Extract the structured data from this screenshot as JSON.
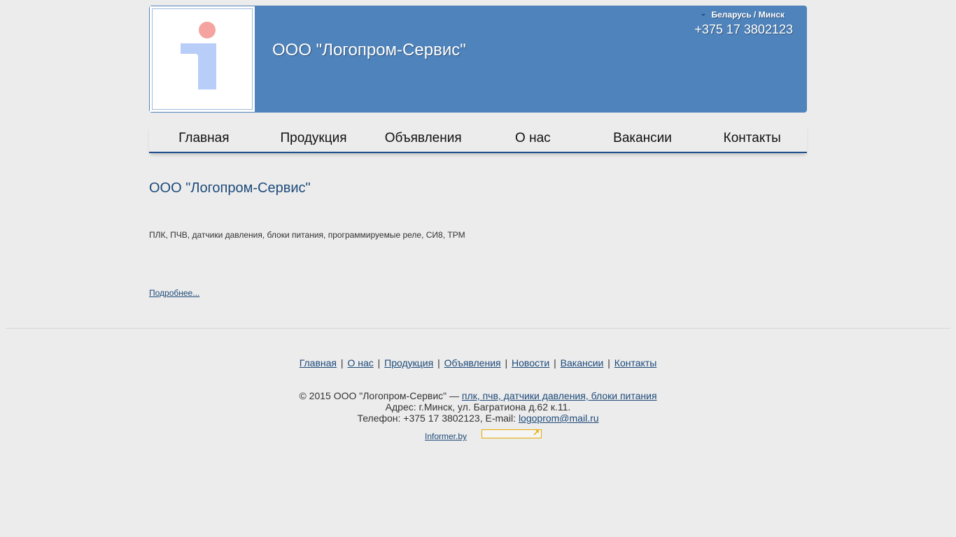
{
  "header": {
    "company_name": "ООО \"Логопром-Сервис\"",
    "region": "Беларусь / Минск",
    "phone": "+375 17 3802123",
    "logo_colors": {
      "dot": "#f4a3a0",
      "stem": "#b8cdf8"
    },
    "background_color": "#4f83bb"
  },
  "nav": {
    "items": [
      "Главная",
      "Продукция",
      "Объявления",
      "О нас",
      "Вакансии",
      "Контакты"
    ]
  },
  "main": {
    "title": "ООО \"Логопром-Сервис\"",
    "description": "ПЛК, ПЧВ, датчики давления, блоки питания, программируемые реле, СИ8, ТРМ",
    "more_link": "Подробнее..."
  },
  "footer": {
    "links": [
      "Главная",
      "О нас",
      "Продукция",
      "Объявления",
      "Новости",
      "Вакансии",
      "Контакты"
    ],
    "separator": "|",
    "copyright_prefix": "© 2015 ООО \"Логопром-Сервис\" — ",
    "copyright_link": "плк, пчв, датчики давления, блоки питания",
    "address": "Адрес: г.Минск, ул. Багратиона д.62 к.11.",
    "phone_email_prefix": "Телефон: +375 17 3802123, E-mail: ",
    "email": "logoprom@mail.ru",
    "informer_link": "Informer.by",
    "informer_icon": "arrow-up-right-icon"
  }
}
